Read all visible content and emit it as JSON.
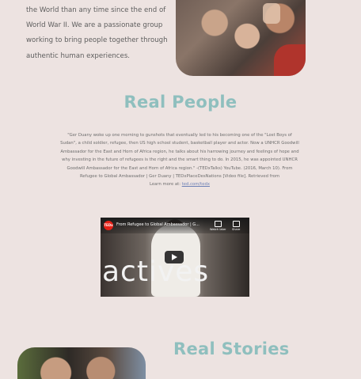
{
  "intro": {
    "text": "the World than any time since the end of World War II. We are a passionate group working to bring people together through authentic human experiences."
  },
  "sections": {
    "people_heading": "Real People",
    "stories_heading": "Real Stories"
  },
  "description": {
    "text": "\"Ger Duany woke up one morning to gunshots that eventually led to his becoming one of the \"Lost Boys of Sudan\", a child soldier, refugee, then US high school student, basketball player and actor. Now a UNHCR Goodwill Ambassador for the East and Horn of Africa region, he talks about his harrowing journey and feelings of hope and why investing in the future of refugees is the right and the smart thing to do. In 2015, he was appointed UNHCR Goodwill Ambassador for the East and Horn of Africa region.\" -(TEDxTalks) YouTube. (2016, March 10). From Refugee to Global Ambassador | Ger Duany | TEDxPlaceDesNations [Video file]. Retrieved from",
    "learn_more_label": "Learn more at:",
    "link": "ted.com/tedx"
  },
  "video": {
    "channel_badge": "TEDx",
    "title": "From Refugee to Global Ambassador | G...",
    "watch_later": "Watch later",
    "share": "Share",
    "frame_text": "actives"
  }
}
